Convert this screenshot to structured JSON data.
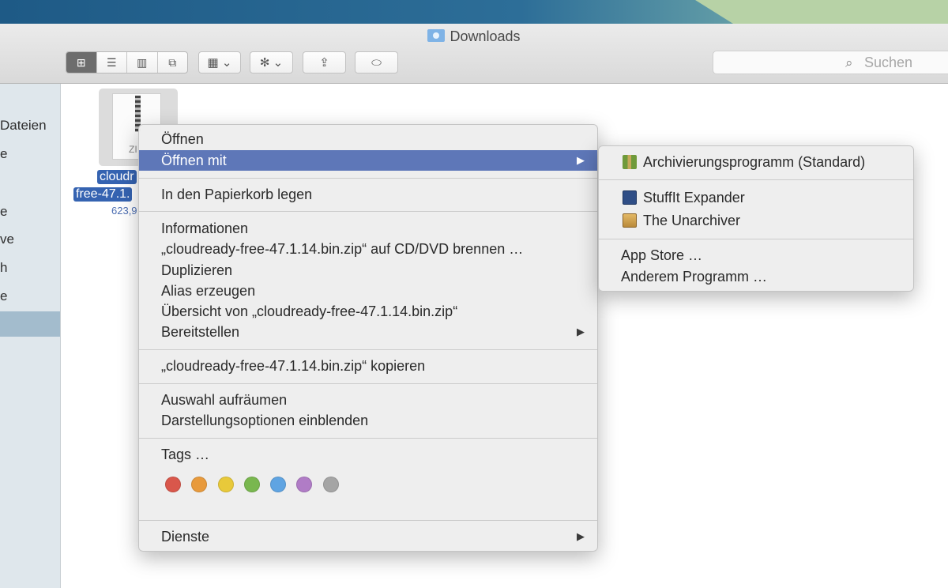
{
  "window": {
    "title": "Downloads"
  },
  "toolbar": {
    "view_icons": "⊞",
    "view_list": "☰",
    "view_columns": "▥",
    "view_coverflow": "⧉",
    "arrange": "▦ ⌄",
    "action": "✻ ⌄",
    "share": "⇪",
    "tag": "⬭"
  },
  "search": {
    "placeholder": "Suchen",
    "icon": "⌕"
  },
  "sidebar": {
    "items": [
      "Dateien",
      "e",
      "e",
      "ve",
      "h",
      "e"
    ]
  },
  "file": {
    "name_line1": "cloudr",
    "name_line2": "free-47.1.",
    "size": "623,9",
    "badge": "ZI"
  },
  "context_menu": {
    "items": {
      "open": "Öffnen",
      "open_with": "Öffnen mit",
      "trash": "In den Papierkorb legen",
      "info": "Informationen",
      "burn": "„cloudready-free-47.1.14.bin.zip“ auf CD/DVD brennen …",
      "duplicate": "Duplizieren",
      "alias": "Alias erzeugen",
      "quicklook": "Übersicht von „cloudready-free-47.1.14.bin.zip“",
      "share": "Bereitstellen",
      "copy": "„cloudready-free-47.1.14.bin.zip“ kopieren",
      "cleanup": "Auswahl aufräumen",
      "view_options": "Darstellungsoptionen einblenden",
      "tags": "Tags …",
      "services": "Dienste"
    },
    "arrow": "▶",
    "tag_colors": [
      "#d9574b",
      "#e89a3c",
      "#e8c93a",
      "#79b74f",
      "#5fa4e2",
      "#b07cc6",
      "#a5a5a5"
    ]
  },
  "open_with_submenu": {
    "items": {
      "archive_utility": "Archivierungsprogramm (Standard)",
      "stuffit": "StuffIt Expander",
      "unarchiver": "The Unarchiver",
      "app_store": "App Store …",
      "other": "Anderem Programm …"
    }
  }
}
